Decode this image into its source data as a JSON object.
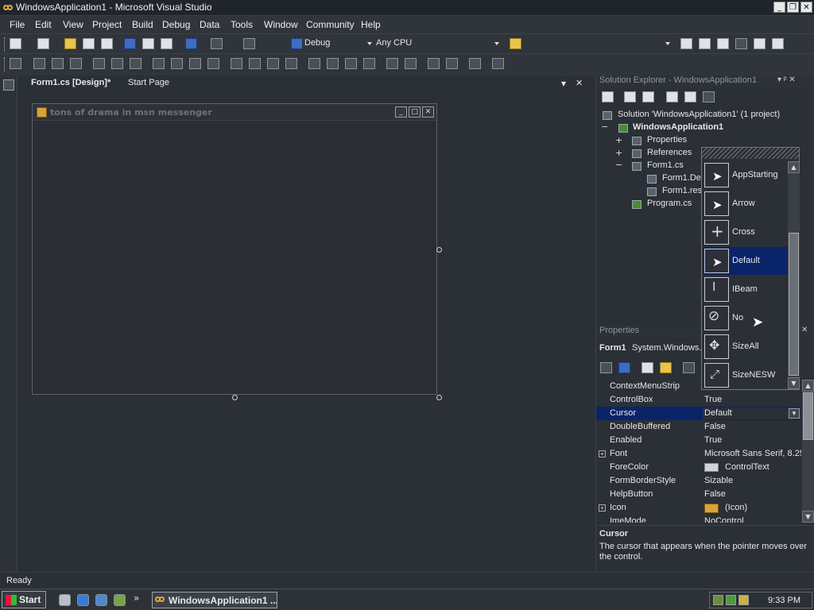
{
  "window": {
    "title": "WindowsApplication1 - Microsoft Visual Studio",
    "minimize": "_",
    "restore": "❐",
    "close": "✕"
  },
  "menu": [
    "File",
    "Edit",
    "View",
    "Project",
    "Build",
    "Debug",
    "Data",
    "Tools",
    "Window",
    "Community",
    "Help"
  ],
  "toolbar": {
    "config": "Debug",
    "platform": "Any CPU"
  },
  "tabs": {
    "design": "Form1.cs [Design]*",
    "start": "Start Page",
    "dropdown": "▾",
    "close": "✕"
  },
  "form": {
    "title": "tons of drama in msn messenger",
    "min": "_",
    "max": "□",
    "close": "✕"
  },
  "solution_explorer": {
    "header": "Solution Explorer - WindowsApplication1",
    "pin": "▾ ᵖ ✕",
    "solution": "Solution 'WindowsApplication1' (1 project)",
    "project": "WindowsApplication1",
    "properties": "Properties",
    "references": "References",
    "form1": "Form1.cs",
    "form1_designer": "Form1.Des",
    "form1_resx": "Form1.res",
    "program": "Program.cs"
  },
  "properties": {
    "header": "Properties",
    "object": "Form1",
    "type": "System.Windows.F",
    "rows": [
      {
        "name": "ContextMenuStrip",
        "value": ""
      },
      {
        "name": "ControlBox",
        "value": "True"
      },
      {
        "name": "Cursor",
        "value": "Default"
      },
      {
        "name": "DoubleBuffered",
        "value": "False"
      },
      {
        "name": "Enabled",
        "value": "True"
      },
      {
        "name": "Font",
        "value": "Microsoft Sans Serif, 8.25"
      },
      {
        "name": "ForeColor",
        "value": "ControlText"
      },
      {
        "name": "FormBorderStyle",
        "value": "Sizable"
      },
      {
        "name": "HelpButton",
        "value": "False"
      },
      {
        "name": "Icon",
        "value": "(Icon)"
      },
      {
        "name": "ImeMode",
        "value": "NoControl"
      }
    ],
    "desc_title": "Cursor",
    "desc_text": "The cursor that appears when the pointer moves over the control."
  },
  "cursor_dropdown": {
    "items": [
      "AppStarting",
      "Arrow",
      "Cross",
      "Default",
      "IBeam",
      "No",
      "SizeAll",
      "SizeNESW"
    ],
    "selected": "Default"
  },
  "status": "Ready",
  "taskbar": {
    "start": "Start",
    "task": "WindowsApplication1 ...",
    "time": "9:33 PM",
    "more": "»"
  }
}
